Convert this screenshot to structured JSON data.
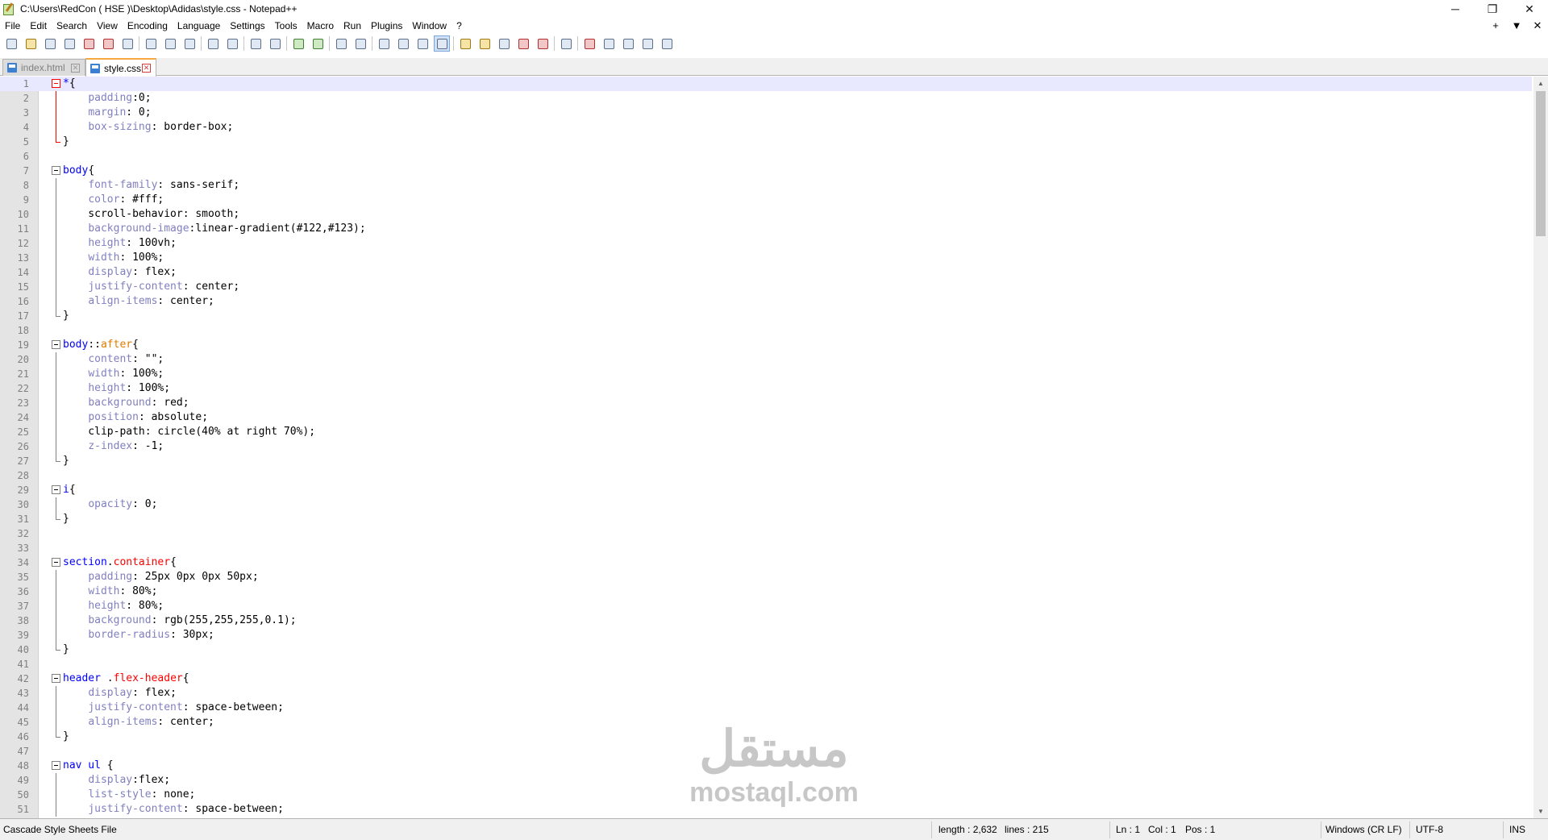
{
  "window": {
    "title": "C:\\Users\\RedCon ( HSE )\\Desktop\\Adidas\\style.css - Notepad++",
    "minimize": "─",
    "restore": "❐",
    "close": "✕"
  },
  "menu": {
    "items": [
      "File",
      "Edit",
      "Search",
      "View",
      "Encoding",
      "Language",
      "Settings",
      "Tools",
      "Macro",
      "Run",
      "Plugins",
      "Window",
      "?"
    ],
    "right_plus": "+",
    "right_down": "▼",
    "right_close": "✕"
  },
  "toolbar": {
    "buttons": [
      "new",
      "open",
      "save",
      "save-all",
      "close",
      "close-all",
      "print",
      "cut",
      "copy",
      "paste",
      "undo",
      "redo",
      "find",
      "replace",
      "zoom-in",
      "zoom-out",
      "sync-v",
      "sync-h",
      "word-wrap",
      "show-all-chars",
      "show-chars-menu",
      "indent-guide",
      "lang-udl",
      "doc-map",
      "function-list",
      "folder-as-workspace",
      "doc-list",
      "monitor",
      "record-macro",
      "stop-record",
      "play-macro",
      "run-macro-multiple",
      "save-macro"
    ]
  },
  "tabs": [
    {
      "label": "index.html",
      "active": false
    },
    {
      "label": "style.css",
      "active": true
    }
  ],
  "editor": {
    "current_line": 1,
    "lines": [
      {
        "n": "1",
        "t": [
          [
            "sel",
            "*"
          ],
          [
            "val",
            "{"
          ]
        ],
        "fold": "start",
        "red": true
      },
      {
        "n": "2",
        "t": [
          [
            "val",
            "    "
          ],
          [
            "prop",
            "padding"
          ],
          [
            "val",
            ":0;"
          ]
        ],
        "fold": "mid",
        "red": true
      },
      {
        "n": "3",
        "t": [
          [
            "val",
            "    "
          ],
          [
            "prop",
            "margin"
          ],
          [
            "val",
            ": 0;"
          ]
        ],
        "fold": "mid",
        "red": true
      },
      {
        "n": "4",
        "t": [
          [
            "val",
            "    "
          ],
          [
            "prop",
            "box-sizing"
          ],
          [
            "val",
            ": border-box;"
          ]
        ],
        "fold": "mid",
        "red": true
      },
      {
        "n": "5",
        "t": [
          [
            "val",
            "}"
          ]
        ],
        "fold": "end",
        "red": true
      },
      {
        "n": "6",
        "t": []
      },
      {
        "n": "7",
        "t": [
          [
            "sel",
            "body"
          ],
          [
            "val",
            "{"
          ]
        ],
        "fold": "start"
      },
      {
        "n": "8",
        "t": [
          [
            "val",
            "    "
          ],
          [
            "prop",
            "font-family"
          ],
          [
            "val",
            ": sans-serif;"
          ]
        ],
        "fold": "mid"
      },
      {
        "n": "9",
        "t": [
          [
            "val",
            "    "
          ],
          [
            "prop",
            "color"
          ],
          [
            "val",
            ": #fff;"
          ]
        ],
        "fold": "mid"
      },
      {
        "n": "10",
        "t": [
          [
            "val",
            "    scroll-behavior: smooth;"
          ]
        ],
        "fold": "mid"
      },
      {
        "n": "11",
        "t": [
          [
            "val",
            "    "
          ],
          [
            "prop",
            "background-image"
          ],
          [
            "val",
            ":linear-gradient(#122,#123);"
          ]
        ],
        "fold": "mid"
      },
      {
        "n": "12",
        "t": [
          [
            "val",
            "    "
          ],
          [
            "prop",
            "height"
          ],
          [
            "val",
            ": 100vh;"
          ]
        ],
        "fold": "mid"
      },
      {
        "n": "13",
        "t": [
          [
            "val",
            "    "
          ],
          [
            "prop",
            "width"
          ],
          [
            "val",
            ": 100%;"
          ]
        ],
        "fold": "mid"
      },
      {
        "n": "14",
        "t": [
          [
            "val",
            "    "
          ],
          [
            "prop",
            "display"
          ],
          [
            "val",
            ": flex;"
          ]
        ],
        "fold": "mid"
      },
      {
        "n": "15",
        "t": [
          [
            "val",
            "    "
          ],
          [
            "prop",
            "justify-content"
          ],
          [
            "val",
            ": center;"
          ]
        ],
        "fold": "mid"
      },
      {
        "n": "16",
        "t": [
          [
            "val",
            "    "
          ],
          [
            "prop",
            "align-items"
          ],
          [
            "val",
            ": center;"
          ]
        ],
        "fold": "mid"
      },
      {
        "n": "17",
        "t": [
          [
            "val",
            "}"
          ]
        ],
        "fold": "end"
      },
      {
        "n": "18",
        "t": []
      },
      {
        "n": "19",
        "t": [
          [
            "sel",
            "body"
          ],
          [
            "val",
            "::"
          ],
          [
            "pse",
            "after"
          ],
          [
            "val",
            "{"
          ]
        ],
        "fold": "start"
      },
      {
        "n": "20",
        "t": [
          [
            "val",
            "    "
          ],
          [
            "prop",
            "content"
          ],
          [
            "val",
            ": \"\";"
          ]
        ],
        "fold": "mid"
      },
      {
        "n": "21",
        "t": [
          [
            "val",
            "    "
          ],
          [
            "prop",
            "width"
          ],
          [
            "val",
            ": 100%;"
          ]
        ],
        "fold": "mid"
      },
      {
        "n": "22",
        "t": [
          [
            "val",
            "    "
          ],
          [
            "prop",
            "height"
          ],
          [
            "val",
            ": 100%;"
          ]
        ],
        "fold": "mid"
      },
      {
        "n": "23",
        "t": [
          [
            "val",
            "    "
          ],
          [
            "prop",
            "background"
          ],
          [
            "val",
            ": red;"
          ]
        ],
        "fold": "mid"
      },
      {
        "n": "24",
        "t": [
          [
            "val",
            "    "
          ],
          [
            "prop",
            "position"
          ],
          [
            "val",
            ": absolute;"
          ]
        ],
        "fold": "mid"
      },
      {
        "n": "25",
        "t": [
          [
            "val",
            "    clip-path: circle(40% at right 70%);"
          ]
        ],
        "fold": "mid"
      },
      {
        "n": "26",
        "t": [
          [
            "val",
            "    "
          ],
          [
            "prop",
            "z-index"
          ],
          [
            "val",
            ": -1;"
          ]
        ],
        "fold": "mid"
      },
      {
        "n": "27",
        "t": [
          [
            "val",
            "}"
          ]
        ],
        "fold": "end"
      },
      {
        "n": "28",
        "t": []
      },
      {
        "n": "29",
        "t": [
          [
            "sel",
            "i"
          ],
          [
            "val",
            "{"
          ]
        ],
        "fold": "start"
      },
      {
        "n": "30",
        "t": [
          [
            "val",
            "    "
          ],
          [
            "prop",
            "opacity"
          ],
          [
            "val",
            ": 0;"
          ]
        ],
        "fold": "mid"
      },
      {
        "n": "31",
        "t": [
          [
            "val",
            "}"
          ]
        ],
        "fold": "end"
      },
      {
        "n": "32",
        "t": []
      },
      {
        "n": "33",
        "t": []
      },
      {
        "n": "34",
        "t": [
          [
            "sel",
            "section"
          ],
          [
            "val",
            "."
          ],
          [
            "cls",
            "container"
          ],
          [
            "val",
            "{"
          ]
        ],
        "fold": "start"
      },
      {
        "n": "35",
        "t": [
          [
            "val",
            "    "
          ],
          [
            "prop",
            "padding"
          ],
          [
            "val",
            ": 25px 0px 0px 50px;"
          ]
        ],
        "fold": "mid"
      },
      {
        "n": "36",
        "t": [
          [
            "val",
            "    "
          ],
          [
            "prop",
            "width"
          ],
          [
            "val",
            ": 80%;"
          ]
        ],
        "fold": "mid"
      },
      {
        "n": "37",
        "t": [
          [
            "val",
            "    "
          ],
          [
            "prop",
            "height"
          ],
          [
            "val",
            ": 80%;"
          ]
        ],
        "fold": "mid"
      },
      {
        "n": "38",
        "t": [
          [
            "val",
            "    "
          ],
          [
            "prop",
            "background"
          ],
          [
            "val",
            ": rgb(255,255,255,0.1);"
          ]
        ],
        "fold": "mid"
      },
      {
        "n": "39",
        "t": [
          [
            "val",
            "    "
          ],
          [
            "prop",
            "border-radius"
          ],
          [
            "val",
            ": 30px;"
          ]
        ],
        "fold": "mid"
      },
      {
        "n": "40",
        "t": [
          [
            "val",
            "}"
          ]
        ],
        "fold": "end"
      },
      {
        "n": "41",
        "t": []
      },
      {
        "n": "42",
        "t": [
          [
            "sel",
            "header"
          ],
          [
            "val",
            " ."
          ],
          [
            "cls",
            "flex-header"
          ],
          [
            "val",
            "{"
          ]
        ],
        "fold": "start"
      },
      {
        "n": "43",
        "t": [
          [
            "val",
            "    "
          ],
          [
            "prop",
            "display"
          ],
          [
            "val",
            ": flex;"
          ]
        ],
        "fold": "mid"
      },
      {
        "n": "44",
        "t": [
          [
            "val",
            "    "
          ],
          [
            "prop",
            "justify-content"
          ],
          [
            "val",
            ": space-between;"
          ]
        ],
        "fold": "mid"
      },
      {
        "n": "45",
        "t": [
          [
            "val",
            "    "
          ],
          [
            "prop",
            "align-items"
          ],
          [
            "val",
            ": center;"
          ]
        ],
        "fold": "mid"
      },
      {
        "n": "46",
        "t": [
          [
            "val",
            "}"
          ]
        ],
        "fold": "end"
      },
      {
        "n": "47",
        "t": []
      },
      {
        "n": "48",
        "t": [
          [
            "sel",
            "nav ul"
          ],
          [
            "val",
            " {"
          ]
        ],
        "fold": "start"
      },
      {
        "n": "49",
        "t": [
          [
            "val",
            "    "
          ],
          [
            "prop",
            "display"
          ],
          [
            "val",
            ":flex;"
          ]
        ],
        "fold": "mid"
      },
      {
        "n": "50",
        "t": [
          [
            "val",
            "    "
          ],
          [
            "prop",
            "list-style"
          ],
          [
            "val",
            ": none;"
          ]
        ],
        "fold": "mid"
      },
      {
        "n": "51",
        "t": [
          [
            "val",
            "    "
          ],
          [
            "prop",
            "justify-content"
          ],
          [
            "val",
            ": space-between;"
          ]
        ],
        "fold": "mid"
      }
    ]
  },
  "watermark": {
    "arabic": "مستقل",
    "latin": "mostaql.com"
  },
  "status": {
    "file_type": "Cascade Style Sheets File",
    "length": "length : 2,632",
    "lines": "lines : 215",
    "ln": "Ln : 1",
    "col": "Col : 1",
    "pos": "Pos : 1",
    "eol": "Windows (CR LF)",
    "encoding": "UTF-8",
    "mode": "INS"
  },
  "colors": {
    "selector": "#0000ff",
    "property": "#8080c0",
    "pseudo": "#e07b00",
    "class": "#ff0000",
    "current_line": "#e8e8ff",
    "tab_accent": "#f7a83e"
  }
}
